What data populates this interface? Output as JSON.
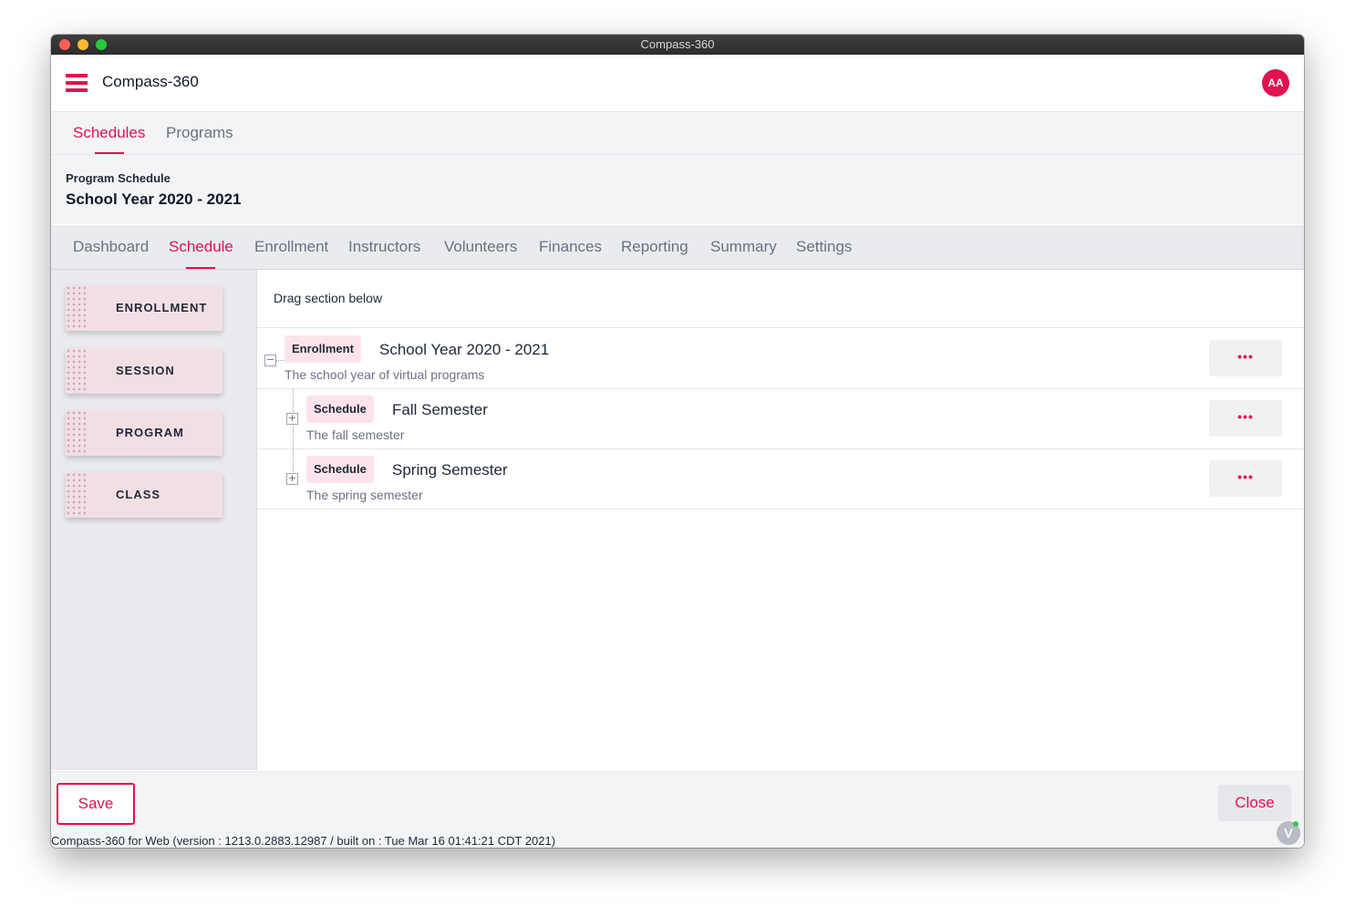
{
  "window": {
    "title": "Compass-360"
  },
  "appbar": {
    "title": "Compass-360",
    "avatar_initials": "AA"
  },
  "top_tabs": [
    {
      "label": "Schedules",
      "active": true
    },
    {
      "label": "Programs",
      "active": false
    }
  ],
  "program": {
    "label": "Program Schedule",
    "title": "School Year 2020 - 2021"
  },
  "sub_tabs": [
    {
      "label": "Dashboard"
    },
    {
      "label": "Schedule",
      "active": true
    },
    {
      "label": "Enrollment"
    },
    {
      "label": "Instructors"
    },
    {
      "label": "Volunteers"
    },
    {
      "label": "Finances"
    },
    {
      "label": "Reporting"
    },
    {
      "label": "Summary"
    },
    {
      "label": "Settings"
    }
  ],
  "drag_items": [
    {
      "label": "ENROLLMENT"
    },
    {
      "label": "SESSION"
    },
    {
      "label": "PROGRAM"
    },
    {
      "label": "CLASS"
    }
  ],
  "main": {
    "hint": "Drag section below",
    "rows": [
      {
        "badge": "Enrollment",
        "title": "School Year 2020 - 2021",
        "description": "The school year of virtual programs",
        "toggle": "−",
        "more": "•••"
      },
      {
        "badge": "Schedule",
        "title": "Fall Semester",
        "description": "The fall semester",
        "toggle": "+",
        "more": "•••"
      },
      {
        "badge": "Schedule",
        "title": "Spring Semester",
        "description": "The spring semester",
        "toggle": "+",
        "more": "•••"
      }
    ]
  },
  "footer": {
    "save_label": "Save",
    "close_label": "Close",
    "version": "Compass-360 for Web (version : 1213.0.2883.12987 / built on : Tue Mar 16 01:41:21 CDT 2021)"
  },
  "colors": {
    "accent": "#e0124f",
    "badge_bg": "#fde4ea",
    "drag_item_bg": "#f2dfe4"
  },
  "icons": {
    "menu": "hamburger-icon",
    "more": "more-horizontal-icon",
    "collapse": "minus-square-icon",
    "expand": "plus-square-icon"
  }
}
